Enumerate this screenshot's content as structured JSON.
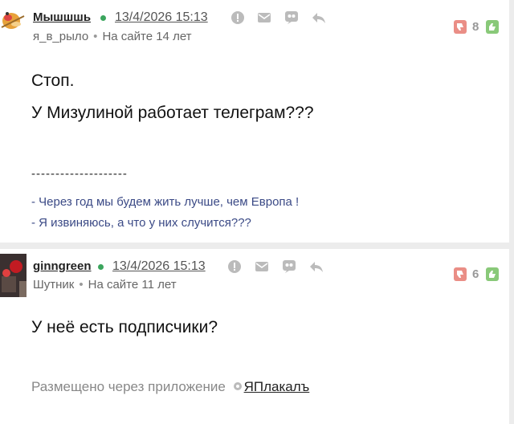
{
  "posts": [
    {
      "author": "Мышшшь",
      "date": "13/4/2026 15:13",
      "rank": "я_в_рыло",
      "tenure": "На сайте 14 лет",
      "score": "8",
      "lines": [
        "Стоп.",
        "У Мизулиной работает телеграм???"
      ],
      "signature_line": "--------------------",
      "quotes": [
        "- Через год мы будем жить лучше, чем Европа !",
        "- Я извиняюсь, а что у них случится???"
      ]
    },
    {
      "author": "ginngreen",
      "date": "13/4/2026 15:13",
      "rank": "Шутник",
      "tenure": "На сайте 11 лет",
      "score": "6",
      "lines": [
        "У неё есть подписчики?"
      ],
      "via_text": "Размещено через приложение",
      "via_link": "ЯПлакалъ"
    }
  ],
  "icons": {
    "status_online": "online-dot",
    "actions": [
      "alert-icon",
      "mail-icon",
      "quote-icon",
      "reply-icon"
    ],
    "vote_down": "thumbs-down-icon",
    "vote_up": "thumbs-up-icon"
  },
  "colors": {
    "online": "#3ba55d",
    "vote_down": "#ea8e86",
    "vote_up": "#89c979",
    "quote": "#3b4a86"
  }
}
